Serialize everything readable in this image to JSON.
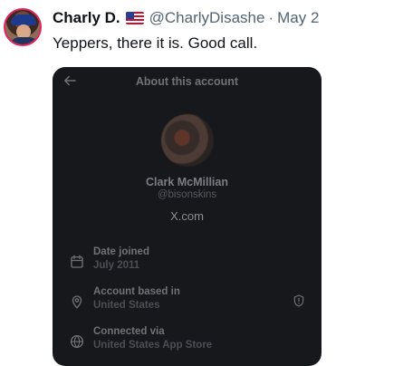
{
  "tweet": {
    "author_name": "Charly D.",
    "author_handle": "@CharlyDisashe",
    "separator": "·",
    "date": "May 2",
    "text": "Yeppers, there it is. Good call."
  },
  "embedded": {
    "title": "About this account",
    "profile_name": "Clark McMillian",
    "profile_handle": "@bisonskins",
    "domain": "X.com",
    "rows": [
      {
        "label": "Date joined",
        "value": "July 2011",
        "icon": "calendar-icon"
      },
      {
        "label": "Account based in",
        "value": "United States",
        "icon": "location-pin-icon",
        "right_icon": "shield-alert-icon"
      },
      {
        "label": "Connected via",
        "value": "United States App Store",
        "icon": "globe-icon"
      }
    ]
  },
  "colors": {
    "card_bg": "#16181c",
    "page_bg": "#ffffff",
    "muted_text": "#536471"
  }
}
